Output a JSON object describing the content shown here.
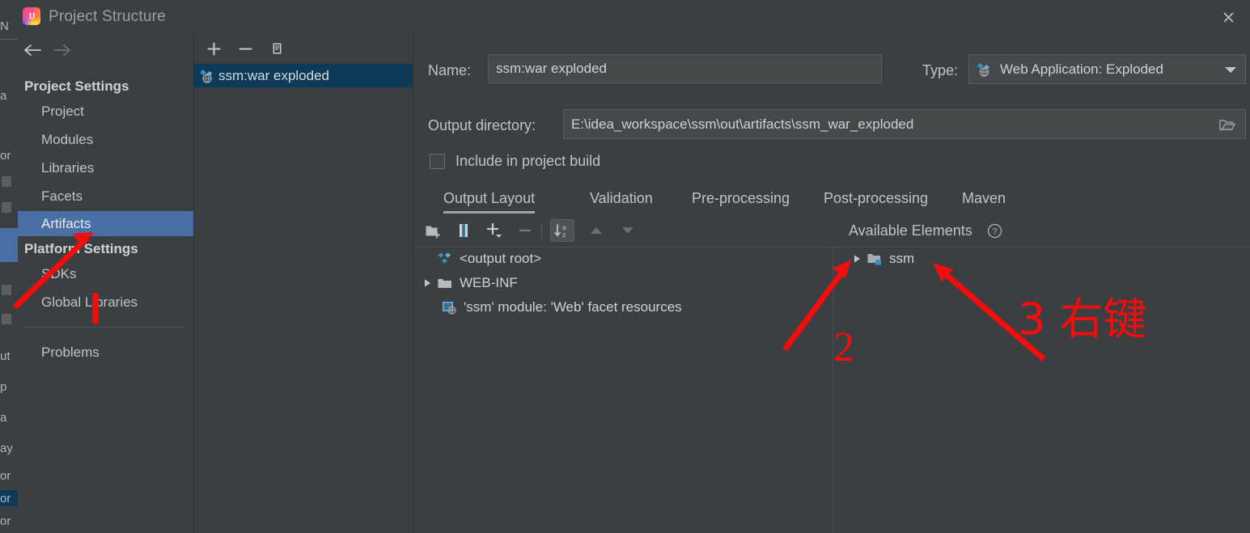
{
  "window": {
    "title": "Project Structure",
    "app_icon": "intellij-idea-icon",
    "close_label": "✕"
  },
  "sidebar": {
    "nav": {
      "back_label": "←",
      "forward_label": "→"
    },
    "groups": [
      {
        "title": "Project Settings",
        "items": [
          {
            "label": "Project",
            "selected": false
          },
          {
            "label": "Modules",
            "selected": false
          },
          {
            "label": "Libraries",
            "selected": false
          },
          {
            "label": "Facets",
            "selected": false
          },
          {
            "label": "Artifacts",
            "selected": true
          }
        ]
      },
      {
        "title": "Platform Settings",
        "items": [
          {
            "label": "SDKs",
            "selected": false
          },
          {
            "label": "Global Libraries",
            "selected": false
          }
        ]
      }
    ],
    "footer_items": [
      {
        "label": "Problems",
        "selected": false
      }
    ]
  },
  "artifacts_panel": {
    "toolbar": [
      {
        "name": "add-artifact-button",
        "glyph": "+"
      },
      {
        "name": "remove-artifact-button",
        "glyph": "−"
      },
      {
        "name": "copy-artifact-button",
        "glyph": "copy-icon"
      }
    ],
    "items": [
      {
        "label": "ssm:war exploded",
        "icon": "web-application-exploded-icon",
        "selected": true
      }
    ]
  },
  "detail": {
    "name_label": "Name:",
    "name_value": "ssm:war exploded",
    "type_label": "Type:",
    "type_value": "Web Application: Exploded",
    "type_icon": "web-application-exploded-icon",
    "output_dir_label": "Output directory:",
    "output_dir_value": "E:\\idea_workspace\\ssm\\out\\artifacts\\ssm_war_exploded",
    "browse_icon": "folder-browse-icon",
    "include_in_build_label": "Include in project build",
    "include_in_build_checked": false,
    "tabs": [
      {
        "label": "Output Layout",
        "active": true
      },
      {
        "label": "Validation",
        "active": false
      },
      {
        "label": "Pre-processing",
        "active": false
      },
      {
        "label": "Post-processing",
        "active": false
      },
      {
        "label": "Maven",
        "active": false
      }
    ],
    "layout_toolbar": [
      {
        "name": "create-directory-button",
        "icon": "new-folder-icon",
        "enabled": true,
        "pressed": false
      },
      {
        "name": "create-archive-button",
        "icon": "archive-icon",
        "enabled": true,
        "pressed": false
      },
      {
        "name": "add-copy-of-button",
        "icon": "plus-dropdown-icon",
        "enabled": true,
        "pressed": false
      },
      {
        "name": "remove-element-button",
        "icon": "minus-icon",
        "enabled": false,
        "pressed": false
      },
      {
        "name": "sort-alphabetically-button",
        "icon": "sort-az-icon",
        "enabled": true,
        "pressed": true
      },
      {
        "name": "move-up-button",
        "icon": "arrow-up-icon",
        "enabled": false,
        "pressed": false
      },
      {
        "name": "move-down-button",
        "icon": "arrow-down-icon",
        "enabled": false,
        "pressed": false
      }
    ],
    "available_elements_label": "Available Elements",
    "help_icon": "question-mark-icon",
    "output_tree": [
      {
        "label": "<output root>",
        "icon": "output-root-icon",
        "indent": 0,
        "expander": "none"
      },
      {
        "label": "WEB-INF",
        "icon": "folder-icon",
        "indent": 0,
        "expander": "collapsed"
      },
      {
        "label": "'ssm' module: 'Web' facet resources",
        "icon": "web-facet-resources-icon",
        "indent": 1,
        "expander": "none"
      }
    ],
    "available_tree": [
      {
        "label": "ssm",
        "icon": "module-folder-icon",
        "indent": 0,
        "expander": "collapsed"
      }
    ]
  },
  "annotations": [
    {
      "name": "annotation-1",
      "text": "1"
    },
    {
      "name": "annotation-2",
      "text": "2"
    },
    {
      "name": "annotation-3",
      "text": "3 右键"
    }
  ],
  "background_window": {
    "fragments": [
      "N",
      "a",
      "or",
      "p",
      "a",
      "ay",
      "or",
      "or",
      "or",
      "ut"
    ]
  },
  "colors": {
    "panel_bg": "#3c3f41",
    "selection_blue": "#4a6fa5",
    "list_selection": "#0d3a58",
    "text": "#bfc3c6",
    "annotation_red": "#f60c0c"
  }
}
